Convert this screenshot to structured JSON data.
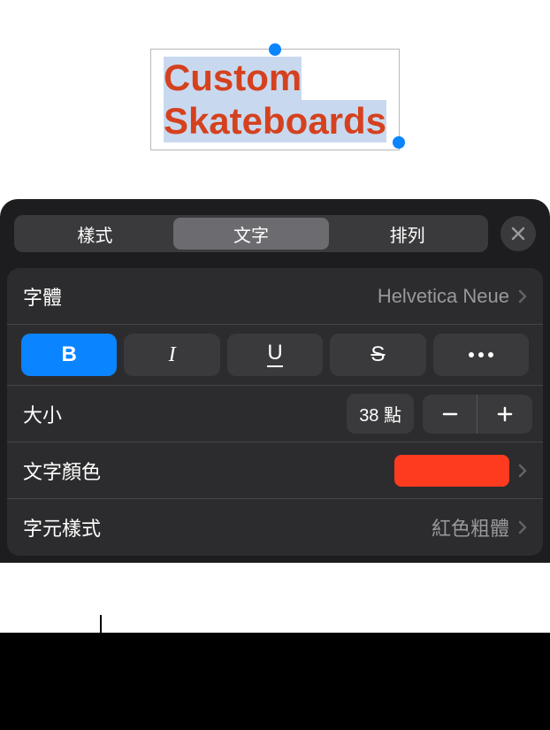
{
  "canvas": {
    "text_line1": "Custom",
    "text_line2": "Skateboards"
  },
  "tabs": {
    "style": "樣式",
    "text": "文字",
    "arrange": "排列"
  },
  "rows": {
    "font": {
      "label": "字體",
      "value": "Helvetica Neue"
    },
    "style_buttons": {
      "bold": "B",
      "italic": "I",
      "underline": "U",
      "strike": "S"
    },
    "size": {
      "label": "大小",
      "value": "38 點"
    },
    "color": {
      "label": "文字顏色",
      "swatch": "#ff3b1f"
    },
    "char_style": {
      "label": "字元樣式",
      "value": "紅色粗體"
    }
  }
}
